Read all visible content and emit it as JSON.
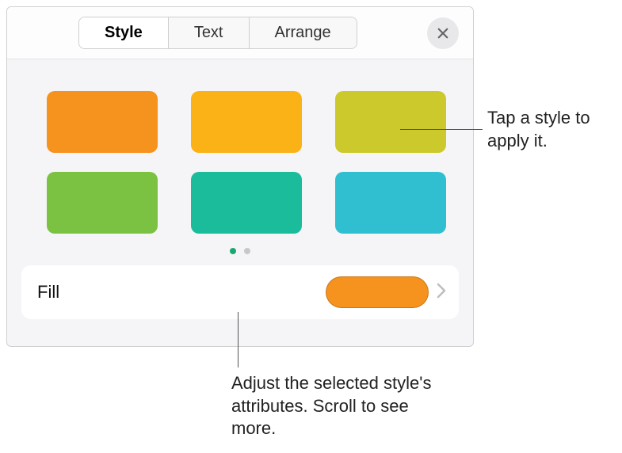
{
  "tabs": {
    "style": "Style",
    "text": "Text",
    "arrange": "Arrange"
  },
  "swatches": {
    "c0": "#f6921e",
    "c1": "#fbb216",
    "c2": "#ccc92d",
    "c3": "#7cc242",
    "c4": "#1abc9c",
    "c5": "#30bfd1"
  },
  "fill": {
    "label": "Fill",
    "color": "#f6921e"
  },
  "callouts": {
    "apply": "Tap a style to apply it.",
    "adjust": "Adjust the selected style's attributes. Scroll to see more."
  }
}
